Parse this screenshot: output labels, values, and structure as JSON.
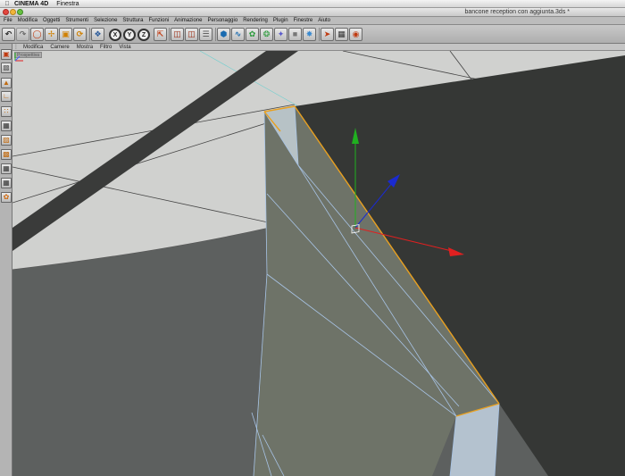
{
  "os_menubar": {
    "app_name": "CINEMA 4D",
    "window_menu": "Finestra"
  },
  "window": {
    "title": "bancone reception con aggiunta.3ds *"
  },
  "main_menu": [
    "File",
    "Modifica",
    "Oggetti",
    "Strumenti",
    "Selezione",
    "Struttura",
    "Funzioni",
    "Animazione",
    "Personaggio",
    "Rendering",
    "Plugin",
    "Finestre",
    "Aiuto"
  ],
  "toolbar": {
    "axis_x": "X",
    "axis_y": "Y",
    "axis_z": "Z",
    "icons": [
      "undo-icon",
      "redo-icon",
      "live-select-icon",
      "move-icon",
      "scale-icon",
      "rotate-icon",
      "world-coords-icon",
      "render-view-icon",
      "render-picture-viewer-icon",
      "render-settings-icon",
      "cube-icon",
      "spline-icon",
      "nurbs-icon",
      "array-icon",
      "deformer-icon",
      "scene-icon",
      "light-icon",
      "camera-icon",
      "floor-icon",
      "material-icon"
    ]
  },
  "viewport": {
    "menu": [
      "Modifica",
      "Camere",
      "Mostra",
      "Filtro",
      "Vista"
    ],
    "view_name": "Prospettiva"
  },
  "colors": {
    "selection_edge": "#e8a020",
    "gizmo_x": "#e02020",
    "gizmo_y": "#20b020",
    "gizmo_z": "#1a2ad0",
    "wireframe": "#a8c4e6"
  }
}
